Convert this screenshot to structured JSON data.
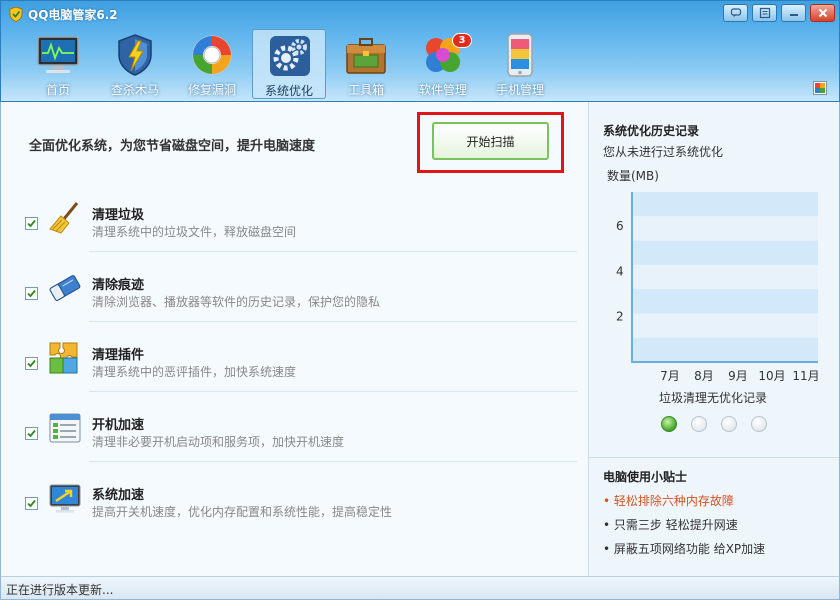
{
  "app": {
    "title": "QQ电脑管家6.2"
  },
  "toolbar": [
    {
      "label": "首页",
      "icon": "monitor-icon",
      "active": false
    },
    {
      "label": "查杀木马",
      "icon": "shield-lightning-icon",
      "active": false
    },
    {
      "label": "修复漏洞",
      "icon": "repair-ring-icon",
      "active": false
    },
    {
      "label": "系统优化",
      "icon": "gears-icon",
      "active": true
    },
    {
      "label": "工具箱",
      "icon": "toolbox-icon",
      "active": false
    },
    {
      "label": "软件管理",
      "icon": "flower-apps-icon",
      "active": false,
      "badge": "3"
    },
    {
      "label": "手机管理",
      "icon": "phone-icon",
      "active": false
    }
  ],
  "main": {
    "intro": "全面优化系统，为您节省磁盘空间，提升电脑速度",
    "scan_button": "开始扫描",
    "features": [
      {
        "name": "清理垃圾",
        "desc": "清理系统中的垃圾文件，释放磁盘空间",
        "checked": true
      },
      {
        "name": "清除痕迹",
        "desc": "清除浏览器、播放器等软件的历史记录，保护您的隐私",
        "checked": true
      },
      {
        "name": "清理插件",
        "desc": "清理系统中的恶评插件，加快系统速度",
        "checked": true
      },
      {
        "name": "开机加速",
        "desc": "清理非必要开机启动项和服务项，加快开机速度",
        "checked": true
      },
      {
        "name": "系统加速",
        "desc": "提高开关机速度，优化内存配置和系统性能，提高稳定性",
        "checked": true
      }
    ]
  },
  "side": {
    "history_title": "系统优化历史记录",
    "history_sub": "您从未进行过系统优化",
    "chart_caption": "垃圾清理无优化记录",
    "tips_title": "电脑使用小贴士",
    "tips": [
      {
        "text": "• 轻松排除六种内存故障",
        "hot": true
      },
      {
        "text": "• 只需三步 轻松提升网速",
        "hot": false
      },
      {
        "text": "• 屏蔽五项网络功能 给XP加速",
        "hot": false
      }
    ],
    "carousel_active": 0,
    "carousel_count": 4
  },
  "chart_data": {
    "type": "bar",
    "ylabel": "数量(MB)",
    "categories": [
      "7月",
      "8月",
      "9月",
      "10月",
      "11月"
    ],
    "yticks": [
      2,
      4,
      6
    ],
    "ylim": [
      0,
      7.5
    ],
    "series": [
      {
        "values": [
          0,
          0,
          0,
          0,
          0
        ]
      }
    ],
    "grid": true
  },
  "status": {
    "text": "正在进行版本更新..."
  },
  "colors": {
    "accent": "#3f9fe0",
    "highlight": "#e0161b",
    "scan_border": "#7ac35c",
    "tip_hot": "#d6521f"
  }
}
